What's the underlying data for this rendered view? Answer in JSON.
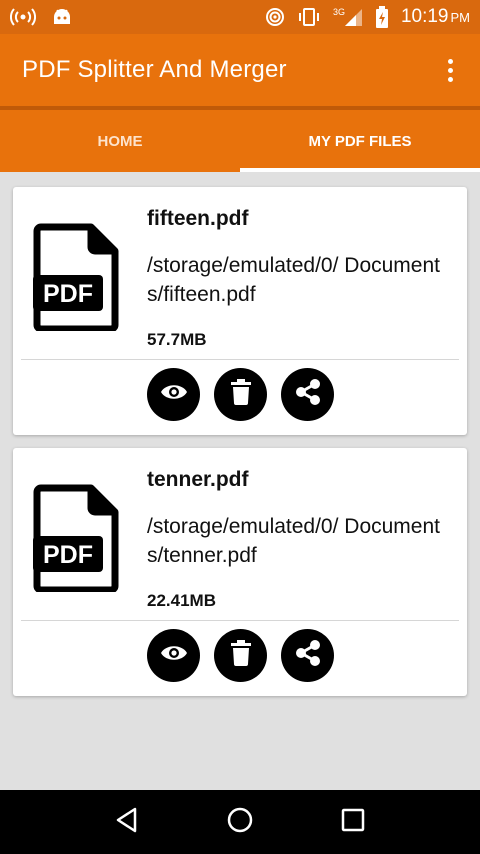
{
  "status_bar": {
    "time": "10:19",
    "ampm": "PM",
    "network_label": "3G",
    "icons": [
      "hotspot-icon",
      "android-icon",
      "wifi-icon",
      "vibrate-icon",
      "signal-icon",
      "battery-charging-icon"
    ]
  },
  "app_bar": {
    "title": "PDF Splitter And Merger",
    "menu_icon": "overflow-menu-icon"
  },
  "tabs": [
    {
      "label": "HOME",
      "selected": false
    },
    {
      "label": "MY PDF FILES",
      "selected": true
    }
  ],
  "files": [
    {
      "name": "fifteen.pdf",
      "path": "/storage/emulated/0/ Documents/fifteen.pdf",
      "size": "57.7MB",
      "icon_label": "PDF",
      "actions": [
        "view-icon",
        "delete-icon",
        "share-icon"
      ]
    },
    {
      "name": "tenner.pdf",
      "path": "/storage/emulated/0/ Documents/tenner.pdf",
      "size": "22.41MB",
      "icon_label": "PDF",
      "actions": [
        "view-icon",
        "delete-icon",
        "share-icon"
      ]
    }
  ],
  "nav_bar": {
    "buttons": [
      "back-icon",
      "home-icon",
      "recents-icon"
    ]
  },
  "colors": {
    "primary": "#e8720c",
    "primary_dark": "#d9690e",
    "tab_indicator": "#ffffff",
    "background": "#e0e0e0"
  }
}
